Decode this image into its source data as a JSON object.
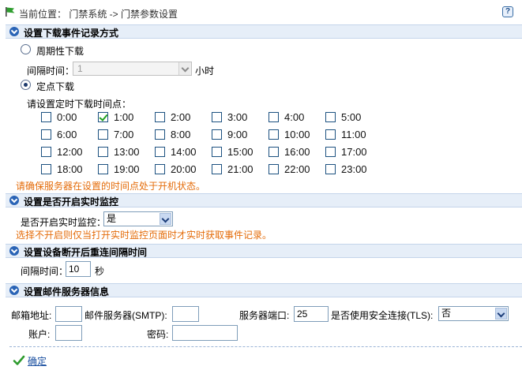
{
  "breadcrumb": {
    "text": "当前位置：  门禁系统  -> 门禁参数设置",
    "help_glyph": "?"
  },
  "sections": {
    "download": "设置下载事件记录方式",
    "realtime": "设置是否开启实时监控",
    "reconnect": "设置设备断开后重连间隔时间",
    "mail": "设置邮件服务器信息"
  },
  "download": {
    "periodic_label": "周期性下载",
    "periodic_checked": false,
    "interval_label": "间隔时间：",
    "interval_value": "1",
    "interval_unit": "小时",
    "fixed_label": "定点下载",
    "fixed_checked": true,
    "timepoints_label": "请设置定时下载时间点：",
    "hours": [
      "0:00",
      "1:00",
      "2:00",
      "3:00",
      "4:00",
      "5:00",
      "6:00",
      "7:00",
      "8:00",
      "9:00",
      "10:00",
      "11:00",
      "12:00",
      "13:00",
      "14:00",
      "15:00",
      "16:00",
      "17:00",
      "18:00",
      "19:00",
      "20:00",
      "21:00",
      "22:00",
      "23:00"
    ],
    "checked_hours": [
      "1:00"
    ],
    "warning": "请确保服务器在设置的时间点处于开机状态。"
  },
  "realtime": {
    "label": "是否开启实时监控：",
    "value": "是",
    "warning": "选择不开启则仅当打开实时监控页面时才实时获取事件记录。"
  },
  "reconnect": {
    "label": "间隔时间：",
    "value": "10",
    "unit": "秒"
  },
  "mail": {
    "email_label": "邮箱地址:",
    "email_value": "",
    "smtp_label": "邮件服务器(SMTP):",
    "smtp_value": "",
    "port_label": "服务器端口:",
    "port_value": "25",
    "tls_label": "是否使用安全连接(TLS):",
    "tls_value": "否",
    "account_label": "账户:",
    "account_value": "",
    "password_label": "密码:",
    "password_value": ""
  },
  "confirm_label": "确定",
  "colors": {
    "accent": "#2a64b6",
    "warning": "#e46c0a",
    "section_bg": "#e6eef8",
    "check": "#21a121"
  }
}
